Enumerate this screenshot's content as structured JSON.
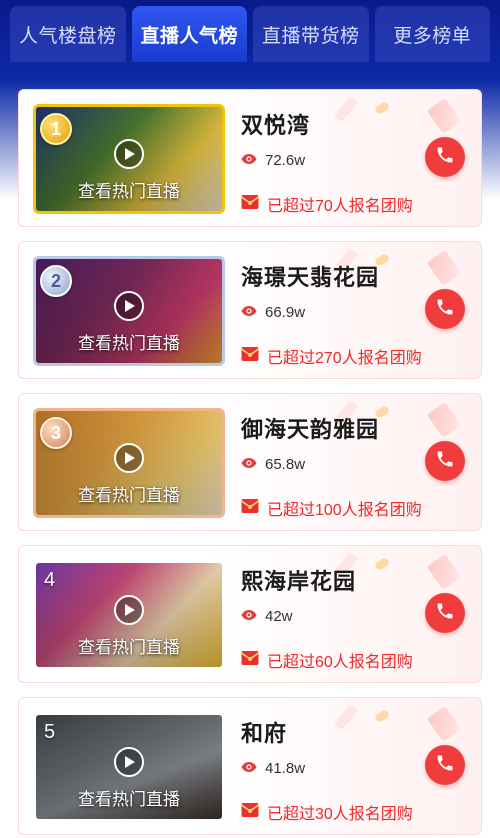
{
  "tabs": [
    {
      "label": "人气楼盘榜",
      "active": false
    },
    {
      "label": "直播人气榜",
      "active": true
    },
    {
      "label": "直播带货榜",
      "active": false
    },
    {
      "label": "更多榜单",
      "active": false
    }
  ],
  "watch_label": "查看热门直播",
  "colors": {
    "accent": "#f03c3c",
    "tab_active": "#1a3bd0",
    "header": "#0a1a8c"
  },
  "icons": {
    "views": "eye-icon",
    "group": "red-envelope-icon",
    "call": "phone-icon",
    "play": "play-icon"
  },
  "items": [
    {
      "rank": "1",
      "name": "双悦湾",
      "views": "72.6w",
      "group": "已超过70人报名团购"
    },
    {
      "rank": "2",
      "name": "海璟天翡花园",
      "views": "66.9w",
      "group": "已超过270人报名团购"
    },
    {
      "rank": "3",
      "name": "御海天韵雅园",
      "views": "65.8w",
      "group": "已超过100人报名团购"
    },
    {
      "rank": "4",
      "name": "熙海岸花园",
      "views": "42w",
      "group": "已超过60人报名团购"
    },
    {
      "rank": "5",
      "name": "和府",
      "views": "41.8w",
      "group": "已超过30人报名团购"
    }
  ]
}
